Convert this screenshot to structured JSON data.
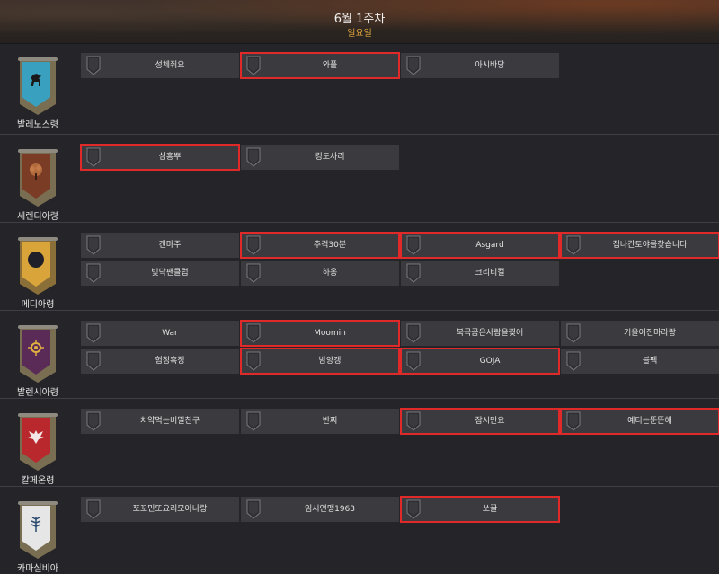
{
  "header": {
    "week_label": "6월 1주차",
    "day_label": "일요일"
  },
  "regions": [
    {
      "name": "발레노스령",
      "slots": [
        {
          "name": "성체줘요",
          "highlighted": false
        },
        {
          "name": "와플",
          "highlighted": true
        },
        {
          "name": "아시바당",
          "highlighted": false
        }
      ]
    },
    {
      "name": "세렌디아령",
      "slots": [
        {
          "name": "심흥뿌",
          "highlighted": true
        },
        {
          "name": "킹도사리",
          "highlighted": false
        }
      ]
    },
    {
      "name": "메디아령",
      "slots": [
        {
          "name": "갠마주",
          "highlighted": false
        },
        {
          "name": "추격30분",
          "highlighted": true
        },
        {
          "name": "Asgard",
          "highlighted": true
        },
        {
          "name": "집나간토야를찾습니다",
          "highlighted": true
        },
        {
          "name": "빛닥팬클럽",
          "highlighted": false
        },
        {
          "name": "하옹",
          "highlighted": false
        },
        {
          "name": "크리티컬",
          "highlighted": false
        }
      ]
    },
    {
      "name": "발렌시아령",
      "slots": [
        {
          "name": "War",
          "highlighted": false
        },
        {
          "name": "Moomin",
          "highlighted": true
        },
        {
          "name": "북극곰은사람을찢어",
          "highlighted": false
        },
        {
          "name": "기울어진마라랑",
          "highlighted": false
        },
        {
          "name": "험정흑정",
          "highlighted": false
        },
        {
          "name": "밤양갱",
          "highlighted": true
        },
        {
          "name": "GOJA",
          "highlighted": true
        },
        {
          "name": "블팩",
          "highlighted": false
        }
      ]
    },
    {
      "name": "칼페온령",
      "slots": [
        {
          "name": "치약먹는비밀친구",
          "highlighted": false
        },
        {
          "name": "반찌",
          "highlighted": false
        },
        {
          "name": "잠시만요",
          "highlighted": true
        },
        {
          "name": "예티는뚠뚠해",
          "highlighted": true
        }
      ]
    },
    {
      "name": "카마실비아",
      "slots": [
        {
          "name": "쪼꼬민또요리모아나랑",
          "highlighted": false
        },
        {
          "name": "임시연맹1963",
          "highlighted": false
        },
        {
          "name": "쏘꿀",
          "highlighted": true
        }
      ]
    }
  ],
  "colors": {
    "background": "#252529",
    "slot": "#3b3b3f",
    "highlight": "#e02a2a",
    "day_label": "#e3a63d"
  },
  "emblem_icons": [
    "horse-icon",
    "tree-icon",
    "crescent-icon",
    "sun-eye-icon",
    "winged-crest-icon",
    "wheat-icon"
  ]
}
